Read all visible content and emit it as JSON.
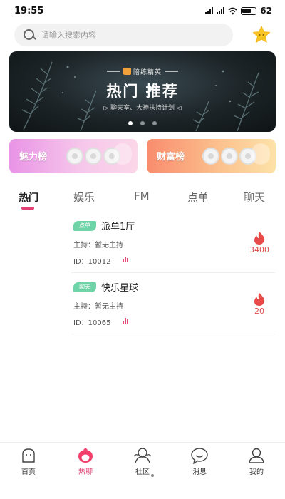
{
  "status_bar": {
    "time": "19:55",
    "battery": "62"
  },
  "search": {
    "placeholder": "请输入搜索内容"
  },
  "banner": {
    "tag": "陪练精英",
    "title": "热门  推荐",
    "subtitle": "▷ 聊天室、大神扶持计划 ◁"
  },
  "rank_cards": [
    {
      "label": "魅力榜"
    },
    {
      "label": "财富榜"
    }
  ],
  "tabs": [
    "热门",
    "娱乐",
    "FM",
    "点单",
    "聊天"
  ],
  "rooms": [
    {
      "badge": "点单",
      "name": "派单1厅",
      "host": "主持：暂无主持",
      "id": "ID：10012",
      "heat": "3400"
    },
    {
      "badge": "聊天",
      "name": "快乐星球",
      "host": "主持：暂无主持",
      "id": "ID：10065",
      "heat": "20"
    }
  ],
  "bottom_nav": [
    "首页",
    "热聊",
    "社区",
    "消息",
    "我的"
  ],
  "colors": {
    "accent": "#e23f72",
    "badge": "#6fd3a8",
    "heat": "#e04a4a",
    "star": "#f7c623"
  }
}
